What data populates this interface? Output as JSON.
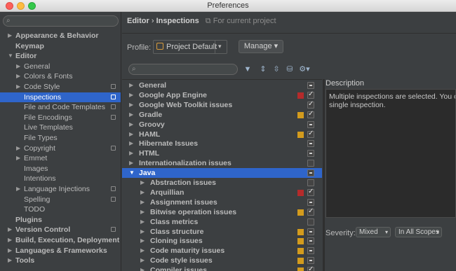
{
  "window": {
    "title": "Preferences"
  },
  "left": {
    "items": [
      {
        "label": "Appearance & Behavior",
        "arrow": "▶",
        "indent": 0,
        "bold": true
      },
      {
        "label": "Keymap",
        "arrow": "",
        "indent": 0,
        "bold": true
      },
      {
        "label": "Editor",
        "arrow": "▼",
        "indent": 0,
        "bold": true
      },
      {
        "label": "General",
        "arrow": "▶",
        "indent": 1
      },
      {
        "label": "Colors & Fonts",
        "arrow": "▶",
        "indent": 1
      },
      {
        "label": "Code Style",
        "arrow": "▶",
        "indent": 1,
        "proj": true
      },
      {
        "label": "Inspections",
        "arrow": "",
        "indent": 1,
        "proj": true,
        "selected": true
      },
      {
        "label": "File and Code Templates",
        "arrow": "",
        "indent": 1,
        "proj": true
      },
      {
        "label": "File Encodings",
        "arrow": "",
        "indent": 1,
        "proj": true
      },
      {
        "label": "Live Templates",
        "arrow": "",
        "indent": 1
      },
      {
        "label": "File Types",
        "arrow": "",
        "indent": 1
      },
      {
        "label": "Copyright",
        "arrow": "▶",
        "indent": 1,
        "proj": true
      },
      {
        "label": "Emmet",
        "arrow": "▶",
        "indent": 1
      },
      {
        "label": "Images",
        "arrow": "",
        "indent": 1
      },
      {
        "label": "Intentions",
        "arrow": "",
        "indent": 1
      },
      {
        "label": "Language Injections",
        "arrow": "▶",
        "indent": 1,
        "proj": true
      },
      {
        "label": "Spelling",
        "arrow": "",
        "indent": 1,
        "proj": true
      },
      {
        "label": "TODO",
        "arrow": "",
        "indent": 1
      },
      {
        "label": "Plugins",
        "arrow": "",
        "indent": 0,
        "bold": true
      },
      {
        "label": "Version Control",
        "arrow": "▶",
        "indent": 0,
        "bold": true,
        "proj": true
      },
      {
        "label": "Build, Execution, Deployment",
        "arrow": "▶",
        "indent": 0,
        "bold": true
      },
      {
        "label": "Languages & Frameworks",
        "arrow": "▶",
        "indent": 0,
        "bold": true
      },
      {
        "label": "Tools",
        "arrow": "▶",
        "indent": 0,
        "bold": true
      }
    ]
  },
  "header": {
    "crumb_parent": "Editor",
    "crumb_sep": "›",
    "crumb_current": "Inspections",
    "project_note": "For current project"
  },
  "profile": {
    "label": "Profile:",
    "value": "Project Default",
    "manage_label": "Manage"
  },
  "inspections": [
    {
      "label": "General",
      "arrow": "▶",
      "indent": 0,
      "color": "",
      "check": "mix"
    },
    {
      "label": "Google App Engine",
      "arrow": "▶",
      "indent": 0,
      "color": "#b52b2b",
      "check": "on"
    },
    {
      "label": "Google Web Toolkit issues",
      "arrow": "▶",
      "indent": 0,
      "color": "",
      "check": "on"
    },
    {
      "label": "Gradle",
      "arrow": "▶",
      "indent": 0,
      "color": "#d39b1d",
      "check": "on"
    },
    {
      "label": "Groovy",
      "arrow": "▶",
      "indent": 0,
      "color": "",
      "check": "mix"
    },
    {
      "label": "HAML",
      "arrow": "▶",
      "indent": 0,
      "color": "#d39b1d",
      "check": "on"
    },
    {
      "label": "Hibernate Issues",
      "arrow": "▶",
      "indent": 0,
      "color": "",
      "check": "mix"
    },
    {
      "label": "HTML",
      "arrow": "▶",
      "indent": 0,
      "color": "",
      "check": "mix"
    },
    {
      "label": "Internationalization issues",
      "arrow": "▶",
      "indent": 0,
      "color": "",
      "check": "off"
    },
    {
      "label": "Java",
      "arrow": "▼",
      "indent": 0,
      "color": "",
      "check": "mix",
      "selected": true
    },
    {
      "label": "Abstraction issues",
      "arrow": "▶",
      "indent": 1,
      "color": "",
      "check": "off"
    },
    {
      "label": "Arquillian",
      "arrow": "▶",
      "indent": 1,
      "color": "#b52b2b",
      "check": "on"
    },
    {
      "label": "Assignment issues",
      "arrow": "▶",
      "indent": 1,
      "color": "",
      "check": "mix"
    },
    {
      "label": "Bitwise operation issues",
      "arrow": "▶",
      "indent": 1,
      "color": "#d39b1d",
      "check": "on"
    },
    {
      "label": "Class metrics",
      "arrow": "▶",
      "indent": 1,
      "color": "",
      "check": "off"
    },
    {
      "label": "Class structure",
      "arrow": "▶",
      "indent": 1,
      "color": "#d39b1d",
      "check": "mix"
    },
    {
      "label": "Cloning issues",
      "arrow": "▶",
      "indent": 1,
      "color": "#d39b1d",
      "check": "mix"
    },
    {
      "label": "Code maturity issues",
      "arrow": "▶",
      "indent": 1,
      "color": "#d39b1d",
      "check": "mix"
    },
    {
      "label": "Code style issues",
      "arrow": "▶",
      "indent": 1,
      "color": "#d39b1d",
      "check": "mix"
    },
    {
      "label": "Compiler issues",
      "arrow": "▶",
      "indent": 1,
      "color": "#d39b1d",
      "check": "on"
    }
  ],
  "description": {
    "header": "Description",
    "line1": "Multiple inspections are selected. You c",
    "line2": "single inspection."
  },
  "severity": {
    "label": "Severity:",
    "value": "Mixed",
    "scope": "In All Scopes"
  }
}
